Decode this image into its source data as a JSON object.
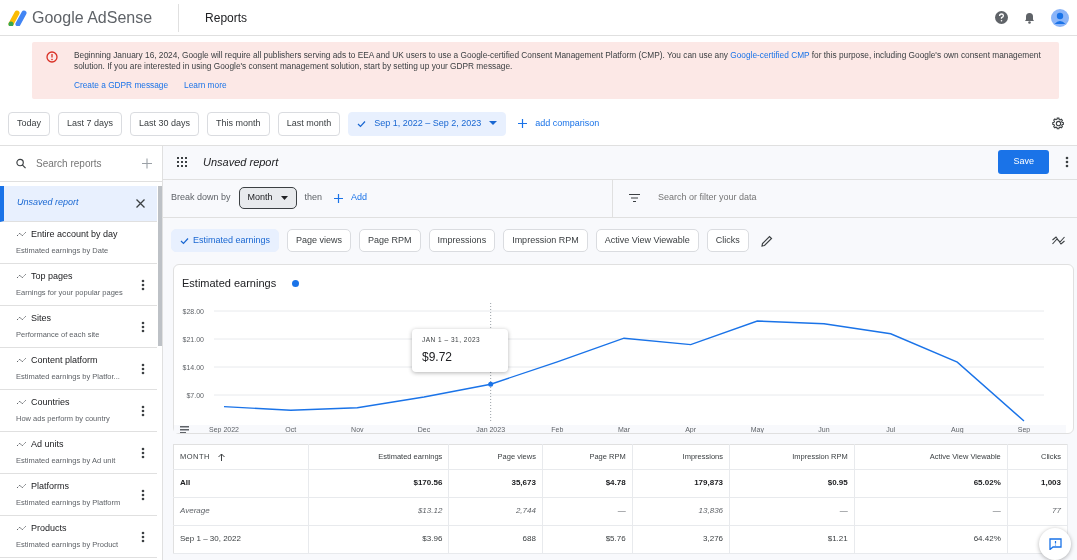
{
  "header": {
    "brand": "Google AdSense",
    "section": "Reports"
  },
  "banner": {
    "text_before": "Beginning January 16, 2024, Google will require all publishers serving ads to EEA and UK users to use a Google-certified Consent Management Platform (CMP). You can use any ",
    "link": "Google-certified CMP",
    "text_after": " for this purpose, including Google's own consent management solution. If you are interested in using Google's consent management solution, start by setting up your GDPR message.",
    "actions": [
      "Create a GDPR message",
      "Learn more"
    ]
  },
  "date_ranges": [
    {
      "label": "Today",
      "selected": false
    },
    {
      "label": "Last 7 days",
      "selected": false
    },
    {
      "label": "Last 30 days",
      "selected": false
    },
    {
      "label": "This month",
      "selected": false
    },
    {
      "label": "Last month",
      "selected": false
    },
    {
      "label": "Sep 1, 2022 – Sep 2, 2023",
      "selected": true
    }
  ],
  "add_comparison": "add comparison",
  "sidebar": {
    "search_placeholder": "Search reports",
    "items": [
      {
        "kind": "unsaved",
        "title": "Unsaved report",
        "selected": true
      },
      {
        "kind": "builtin",
        "title": "Entire account by day",
        "subtitle": "Estimated earnings by Date",
        "selected": false
      },
      {
        "kind": "report",
        "title": "Top pages",
        "subtitle": "Earnings for your popular pages",
        "selected": false
      },
      {
        "kind": "report",
        "title": "Sites",
        "subtitle": "Performance of each site",
        "selected": false
      },
      {
        "kind": "report",
        "title": "Content platform",
        "subtitle": "Estimated earnings by Platfor...",
        "selected": false
      },
      {
        "kind": "report",
        "title": "Countries",
        "subtitle": "How ads perform by country",
        "selected": false
      },
      {
        "kind": "report",
        "title": "Ad units",
        "subtitle": "Estimated earnings by Ad unit",
        "selected": false
      },
      {
        "kind": "report",
        "title": "Platforms",
        "subtitle": "Estimated earnings by Platform",
        "selected": false
      },
      {
        "kind": "report",
        "title": "Products",
        "subtitle": "Estimated earnings by Product",
        "selected": false
      }
    ]
  },
  "report": {
    "title": "Unsaved report",
    "save": "Save",
    "breakdown_label": "Break down by",
    "breakdown_value": "Month",
    "then": "then",
    "add": "Add",
    "filter_placeholder": "Search or filter your data"
  },
  "metrics": [
    {
      "label": "Estimated earnings",
      "selected": true
    },
    {
      "label": "Page views",
      "selected": false
    },
    {
      "label": "Page RPM",
      "selected": false
    },
    {
      "label": "Impressions",
      "selected": false
    },
    {
      "label": "Impression RPM",
      "selected": false
    },
    {
      "label": "Active View Viewable",
      "selected": false
    },
    {
      "label": "Clicks",
      "selected": false
    }
  ],
  "chart": {
    "tooltip_date": "JAN 1 – 31, 2023",
    "tooltip_value": "$9.72",
    "chart_data": {
      "type": "line",
      "grid": true,
      "ref_lines": [
        {
          "axis": "x",
          "value": "Jan 2023"
        }
      ],
      "categories": [
        "Sep 2022",
        "Oct",
        "Nov",
        "Dec",
        "Jan 2023",
        "Feb",
        "Mar",
        "Apr",
        "May",
        "Jun",
        "Jul",
        "Aug",
        "Sep"
      ],
      "series": [
        {
          "name": "Estimated earnings",
          "color": "#1a73e8",
          "values": [
            4.1,
            3.2,
            3.8,
            6.5,
            9.7,
            15.3,
            21.2,
            19.6,
            25.5,
            24.8,
            22.3,
            15.2,
            0.5
          ]
        }
      ],
      "ylim": [
        0,
        30
      ],
      "yticks": [
        {
          "value": 7,
          "label": "$7.00"
        },
        {
          "value": 14,
          "label": "$14.00"
        },
        {
          "value": 21,
          "label": "$21.00"
        },
        {
          "value": 28,
          "label": "$28.00"
        }
      ]
    }
  },
  "table": {
    "columns": [
      "MONTH",
      "Estimated earnings",
      "Page views",
      "Page RPM",
      "Impressions",
      "Impression RPM",
      "Active View Viewable",
      "Clicks"
    ],
    "rows": [
      {
        "kind": "total",
        "cells": [
          "All",
          "$170.56",
          "35,673",
          "$4.78",
          "179,873",
          "$0.95",
          "65.02%",
          "1,003"
        ]
      },
      {
        "kind": "average",
        "cells": [
          "Average",
          "$13.12",
          "2,744",
          "—",
          "13,836",
          "—",
          "—",
          "77"
        ]
      },
      {
        "kind": "data",
        "cells": [
          "Sep 1 – 30, 2022",
          "$3.96",
          "688",
          "$5.76",
          "3,276",
          "$1.21",
          "64.42%",
          ""
        ]
      }
    ]
  }
}
